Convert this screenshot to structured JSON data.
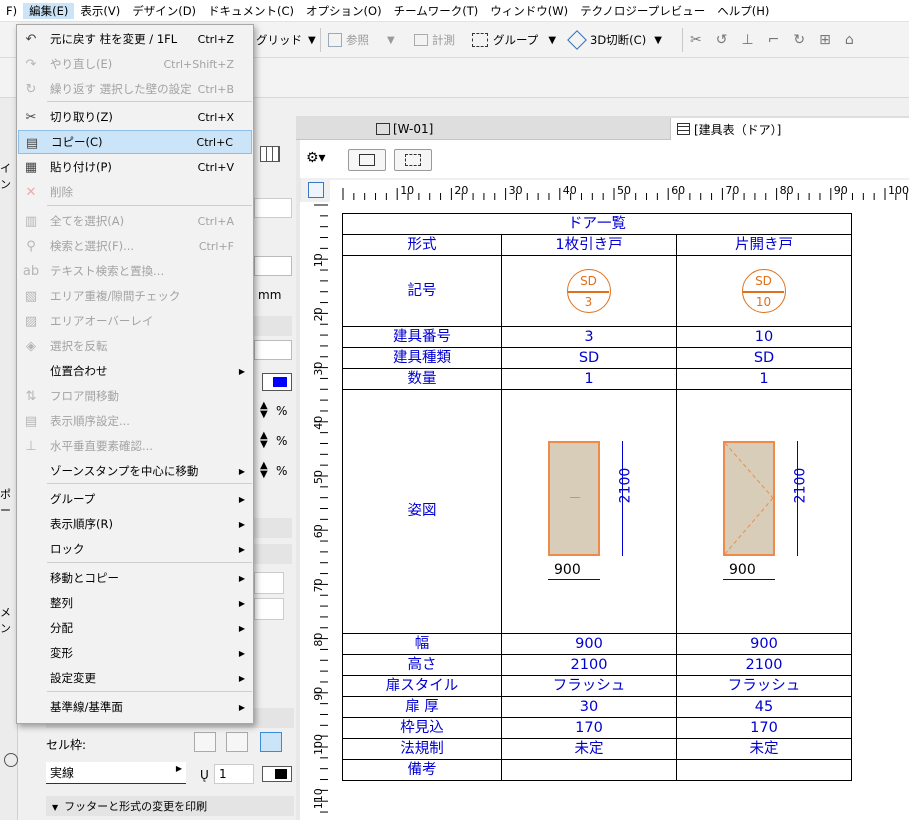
{
  "menubar": [
    "F)",
    "編集(E)",
    "表示(V)",
    "デザイン(D)",
    "ドキュメント(C)",
    "オプション(O)",
    "チームワーク(T)",
    "ウィンドウ(W)",
    "テクノロジープレビュー",
    "ヘルプ(H)"
  ],
  "toolbar": {
    "grid_label": "グリッド",
    "reference_label": "参照",
    "measure_label": "計測",
    "group_label": "グループ",
    "section3d_label": "3D切断(C)"
  },
  "tabs": {
    "plan": "[W-01]",
    "schedule": "[建具表（ドア）]"
  },
  "edit_menu": {
    "items": [
      {
        "label": "元に戻す 柱を変更 / 1FL",
        "shortcut": "Ctrl+Z",
        "icon": "undo-icon"
      },
      {
        "label": "やり直し(E)",
        "shortcut": "Ctrl+Shift+Z",
        "icon": "redo-icon"
      },
      {
        "label": "繰り返す 選択した壁の設定",
        "shortcut": "Ctrl+B",
        "icon": "repeat-icon"
      },
      {
        "label": "切り取り(Z)",
        "shortcut": "Ctrl+X",
        "icon": "scissors-icon"
      },
      {
        "label": "コピー(C)",
        "shortcut": "Ctrl+C",
        "icon": "copy-icon"
      },
      {
        "label": "貼り付け(P)",
        "shortcut": "Ctrl+V",
        "icon": "paste-icon"
      },
      {
        "label": "削除",
        "shortcut": "",
        "icon": "delete-icon"
      },
      {
        "label": "全てを選択(A)",
        "shortcut": "Ctrl+A",
        "icon": "select-all-icon"
      },
      {
        "label": "検索と選択(F)...",
        "shortcut": "Ctrl+F",
        "icon": "find-select-icon"
      },
      {
        "label": "テキスト検索と置換...",
        "shortcut": "",
        "icon": "text-replace-icon"
      },
      {
        "label": "エリア重複/隙間チェック",
        "shortcut": "",
        "icon": "area-check-icon"
      },
      {
        "label": "エリアオーバーレイ",
        "shortcut": "",
        "icon": "area-overlay-icon"
      },
      {
        "label": "選択を反転",
        "shortcut": "",
        "icon": "invert-selection-icon"
      },
      {
        "label": "位置合わせ",
        "shortcut": "",
        "icon": ""
      },
      {
        "label": "フロア間移動",
        "shortcut": "",
        "icon": "floor-move-icon"
      },
      {
        "label": "表示順序設定...",
        "shortcut": "",
        "icon": "display-order-icon"
      },
      {
        "label": "水平垂直要素確認...",
        "shortcut": "",
        "icon": "hv-check-icon"
      },
      {
        "label": "ゾーンスタンプを中心に移動",
        "shortcut": "",
        "icon": ""
      },
      {
        "label": "グループ",
        "shortcut": "",
        "icon": ""
      },
      {
        "label": "表示順序(R)",
        "shortcut": "",
        "icon": ""
      },
      {
        "label": "ロック",
        "shortcut": "",
        "icon": ""
      },
      {
        "label": "移動とコピー",
        "shortcut": "",
        "icon": ""
      },
      {
        "label": "整列",
        "shortcut": "",
        "icon": ""
      },
      {
        "label": "分配",
        "shortcut": "",
        "icon": ""
      },
      {
        "label": "変形",
        "shortcut": "",
        "icon": ""
      },
      {
        "label": "設定変更",
        "shortcut": "",
        "icon": ""
      },
      {
        "label": "基準線/基準面",
        "shortcut": "",
        "icon": ""
      }
    ]
  },
  "infobox": {
    "unit_mm": "mm",
    "percent": "%",
    "cell_frame_label": "セル枠:",
    "line_type": "実線",
    "line_weight": "1",
    "print_footer_label": "フッターと形式の変更を印刷",
    "side_letters": [
      "イン",
      "ポー",
      "メン"
    ]
  },
  "ruler": {
    "h_ticks": [
      "10",
      "20",
      "30",
      "40",
      "50",
      "60",
      "70",
      "80",
      "90",
      "100"
    ],
    "v_ticks": [
      "10",
      "20",
      "30",
      "40",
      "50",
      "60",
      "70",
      "80",
      "90",
      "100",
      "110"
    ]
  },
  "schedule": {
    "title": "ドア一覧",
    "rows": {
      "type": [
        "形式",
        "1枚引き戸",
        "片開き戸"
      ],
      "symbol": [
        "記号"
      ],
      "number": [
        "建具番号",
        "3",
        "10"
      ],
      "kind": [
        "建具種類",
        "SD",
        "SD"
      ],
      "qty": [
        "数量",
        "1",
        "1"
      ],
      "figure": [
        "姿図"
      ],
      "width": [
        "幅",
        "900",
        "900"
      ],
      "height": [
        "高さ",
        "2100",
        "2100"
      ],
      "style": [
        "扉スタイル",
        "フラッシュ",
        "フラッシュ"
      ],
      "thick": [
        "扉 厚",
        "30",
        "45"
      ],
      "frame": [
        "枠見込",
        "170",
        "170"
      ],
      "regulation": [
        "法規制",
        "未定",
        "未定"
      ],
      "remarks": [
        "備考",
        "",
        ""
      ]
    },
    "symbols": [
      {
        "top": "SD",
        "bottom": "3"
      },
      {
        "top": "SD",
        "bottom": "10"
      }
    ],
    "dim_width": "900",
    "dim_height": "2100"
  },
  "colors": {
    "schedule_text": "#0000d0",
    "symbol_orange": "#e0701c",
    "menu_highlight": "#cce4f7"
  }
}
